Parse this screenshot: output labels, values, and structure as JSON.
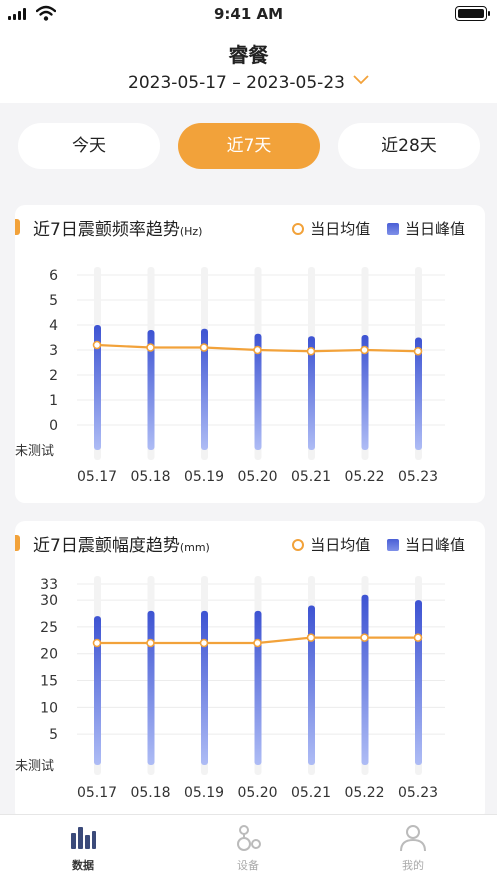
{
  "status_bar": {
    "time": "9:41 AM"
  },
  "header": {
    "title": "睿餐",
    "date_range": "2023-05-17 – 2023-05-23"
  },
  "tabs": [
    {
      "label": "今天",
      "active": false
    },
    {
      "label": "近7天",
      "active": true
    },
    {
      "label": "近28天",
      "active": false
    }
  ],
  "colors": {
    "accent": "#f2a23a",
    "bar": "#4a5fd6"
  },
  "legend": {
    "avg": "当日均值",
    "peak": "当日峰值"
  },
  "cards": [
    {
      "title": "近7日震颤频率趋势",
      "unit": "(Hz)"
    },
    {
      "title": "近7日震颤幅度趋势",
      "unit": "(mm)"
    }
  ],
  "chart_data": [
    {
      "type": "bar",
      "title": "近7日震颤频率趋势",
      "unit": "Hz",
      "categories": [
        "05.17",
        "05.18",
        "05.19",
        "05.20",
        "05.21",
        "05.22",
        "05.23"
      ],
      "yticks": [
        "6",
        "5",
        "4",
        "3",
        "2",
        "1",
        "0",
        "未测试"
      ],
      "ylim": [
        0,
        6
      ],
      "series": [
        {
          "name": "当日峰值",
          "values": [
            4.0,
            3.8,
            3.85,
            3.65,
            3.55,
            3.6,
            3.5
          ]
        },
        {
          "name": "当日均值",
          "values": [
            3.2,
            3.1,
            3.1,
            3.0,
            2.95,
            3.0,
            2.95
          ]
        }
      ]
    },
    {
      "type": "bar",
      "title": "近7日震颤幅度趋势",
      "unit": "mm",
      "categories": [
        "05.17",
        "05.18",
        "05.19",
        "05.20",
        "05.21",
        "05.22",
        "05.23"
      ],
      "yticks": [
        "33",
        "30",
        "25",
        "20",
        "15",
        "10",
        "5",
        "未测试"
      ],
      "ylim": [
        0,
        33
      ],
      "series": [
        {
          "name": "当日峰值",
          "values": [
            27,
            28,
            28,
            28,
            29,
            31,
            30
          ]
        },
        {
          "name": "当日均值",
          "values": [
            22,
            22,
            22,
            22,
            23,
            23,
            23
          ]
        }
      ]
    }
  ],
  "bottom_nav": [
    {
      "label": "数据",
      "icon": "bar-chart-icon",
      "active": true
    },
    {
      "label": "设备",
      "icon": "device-icon",
      "active": false
    },
    {
      "label": "我的",
      "icon": "user-icon",
      "active": false
    }
  ]
}
